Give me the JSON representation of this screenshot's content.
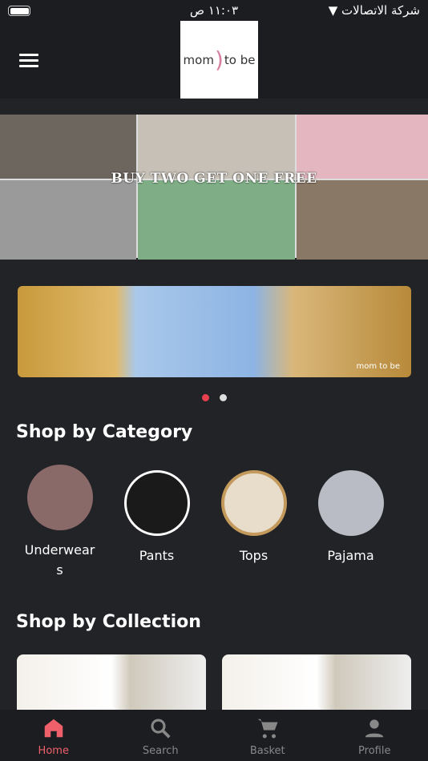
{
  "status": {
    "time": "١١:٠٣ ص",
    "carrier": "شركة الاتصالات"
  },
  "header": {
    "logo_text": "mom to be"
  },
  "promo": {
    "text": "BUY TWO GET ONE FREE"
  },
  "carousel": {
    "watermark": "mom to be",
    "active_index": 0,
    "count": 2
  },
  "category": {
    "title": "Shop by Category",
    "items": [
      {
        "label": "Underwears",
        "color": "#8a6a68"
      },
      {
        "label": "Pants",
        "color": "#1a1a1a"
      },
      {
        "label": "Tops",
        "color": "#e8dccb"
      },
      {
        "label": "Pajama",
        "color": "#b9bcc4"
      }
    ]
  },
  "collection": {
    "title": "Shop by Collection"
  },
  "tabs": [
    {
      "label": "Home",
      "icon": "home-icon",
      "active": true
    },
    {
      "label": "Search",
      "icon": "search-icon"
    },
    {
      "label": "Basket",
      "icon": "cart-icon"
    },
    {
      "label": "Profile",
      "icon": "person-icon"
    }
  ],
  "colors": {
    "accent": "#f0606a",
    "dot_active": "#e8404f"
  }
}
